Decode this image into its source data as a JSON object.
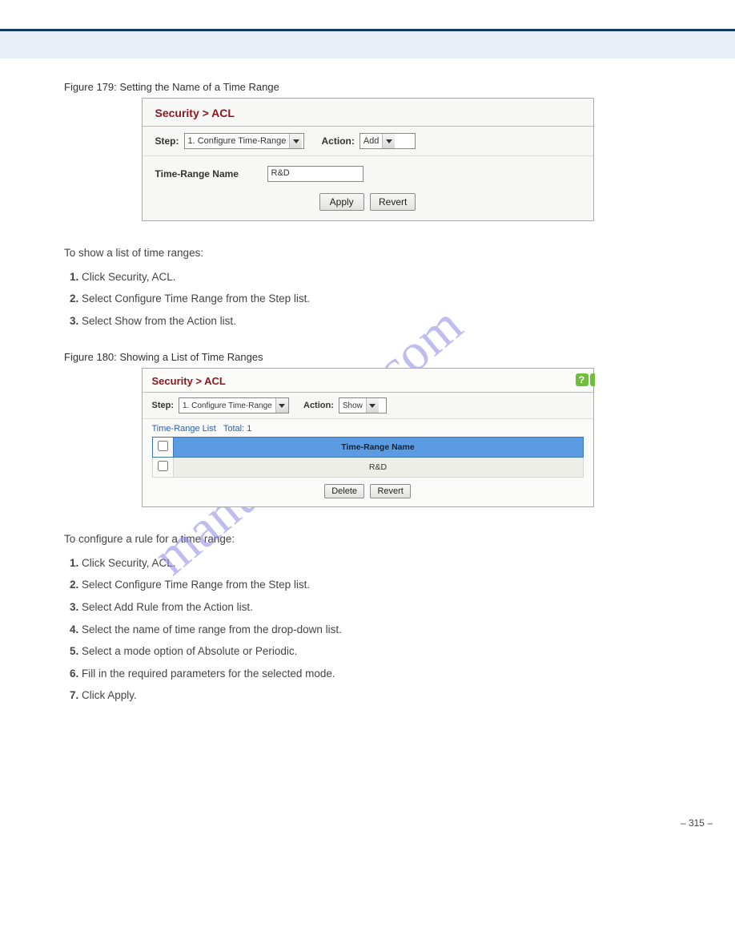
{
  "watermark": "manualshive.com",
  "page_number": "– 315 –",
  "fig1": {
    "label": "Figure 179: Setting the Name of a Time Range",
    "title": "Security > ACL",
    "step_label": "Step:",
    "step_value": "1. Configure Time-Range",
    "action_label": "Action:",
    "action_value": "Add",
    "field_label": "Time-Range Name",
    "field_value": "R&D",
    "apply": "Apply",
    "revert": "Revert"
  },
  "instr1": {
    "line1": "To show a list of time ranges:",
    "s1": "Click Security, ACL.",
    "s2": "Select Configure Time Range from the Step list.",
    "s3": "Select Show from the Action list."
  },
  "fig2": {
    "label": "Figure 180: Showing a List of Time Ranges",
    "title": "Security > ACL",
    "step_label": "Step:",
    "step_value": "1. Configure Time-Range",
    "action_label": "Action:",
    "action_value": "Show",
    "list_caption": "Time-Range List",
    "total_label": "Total:",
    "total_value": "1",
    "col_header": "Time-Range Name",
    "row1": "R&D",
    "delete": "Delete",
    "revert": "Revert",
    "help": "?"
  },
  "instr2": {
    "line1": "To configure a rule for a time range:",
    "s1": "Click Security, ACL.",
    "s2": "Select Configure Time Range from the Step list.",
    "s3": "Select Add Rule from the Action list.",
    "s4": "Select the name of time range from the drop-down list.",
    "s5": "Select a mode option of Absolute or Periodic.",
    "s6": "Fill in the required parameters for the selected mode.",
    "s7": "Click Apply."
  }
}
